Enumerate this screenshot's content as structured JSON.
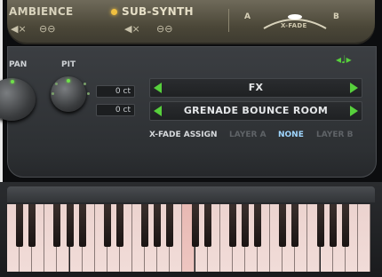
{
  "top": {
    "ambience_label": "AMBIENCE",
    "sub_synth_label": "SUB-SYNTH",
    "mute_glyph": "◀×",
    "link_glyph": "⊖⊖",
    "xfade": {
      "a_label": "A",
      "b_label": "B",
      "knob_label": "X-FADE"
    }
  },
  "panel": {
    "pan_label": "PAN",
    "pit_label": "PIT",
    "fine_1": "0 ct",
    "fine_2": "0 ct",
    "fx_select": "FX",
    "room_select": "GRENADE BOUNCE ROOM",
    "xfade_assign_label": "X-FADE ASSIGN",
    "layer_a_label": "LAYER A",
    "none_label": "NONE",
    "layer_b_label": "LAYER B",
    "music_glyph": "◂♩▸"
  },
  "colors": {
    "accent_green": "#57d03c",
    "accent_gold": "#f0c040",
    "selected_blue": "#9fd6ff",
    "inactive_gray": "#5f6367",
    "key_pink": "#f1dcd8"
  }
}
